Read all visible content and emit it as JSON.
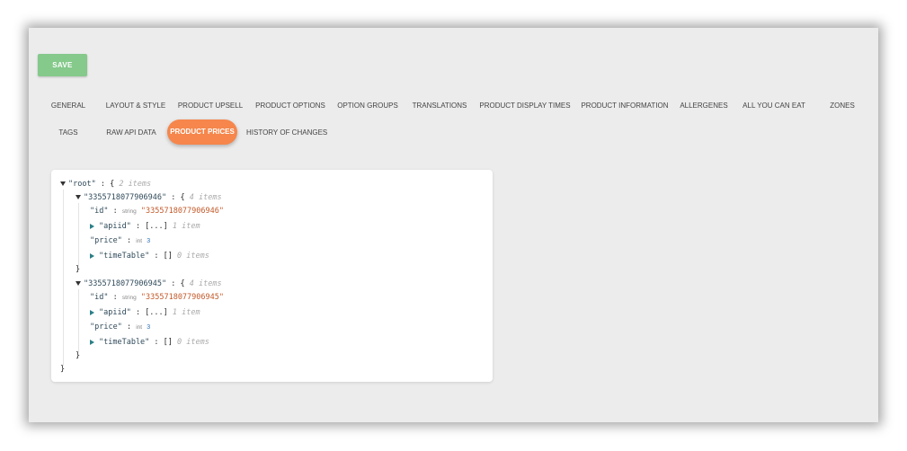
{
  "toolbar": {
    "save_label": "SAVE"
  },
  "tabs": [
    {
      "label": "GENERAL"
    },
    {
      "label": "LAYOUT & STYLE"
    },
    {
      "label": "PRODUCT UPSELL"
    },
    {
      "label": "PRODUCT OPTIONS"
    },
    {
      "label": "OPTION GROUPS"
    },
    {
      "label": "TRANSLATIONS"
    },
    {
      "label": "PRODUCT DISPLAY TIMES"
    },
    {
      "label": "PRODUCT INFORMATION"
    },
    {
      "label": "ALLERGENES"
    },
    {
      "label": "ALL YOU CAN EAT"
    },
    {
      "label": "ZONES"
    },
    {
      "label": "TAGS"
    },
    {
      "label": "RAW API DATA"
    },
    {
      "label": "PRODUCT PRICES"
    },
    {
      "label": "HISTORY OF CHANGES"
    }
  ],
  "active_tab": "PRODUCT PRICES",
  "colors": {
    "save": "#85c98b",
    "active_tab": "#f6864b",
    "string_value": "#c35a2a",
    "int_value": "#2b6fb5"
  },
  "json": {
    "root_key": "\"root\"",
    "root_open": "{",
    "root_count": "2 items",
    "entries": [
      {
        "key": "\"3355718077906946\"",
        "open": "{",
        "count": "4 items",
        "id_key": "\"id\"",
        "id_type": "string",
        "id_value": "\"3355718077906946\"",
        "apiid_key": "\"apiid\"",
        "apiid_value": "[...]",
        "apiid_count": "1 item",
        "price_key": "\"price\"",
        "price_type": "int",
        "price_value": "3",
        "timetable_key": "\"timeTable\"",
        "timetable_value": "[]",
        "timetable_count": "0 items",
        "close": "}"
      },
      {
        "key": "\"3355718077906945\"",
        "open": "{",
        "count": "4 items",
        "id_key": "\"id\"",
        "id_type": "string",
        "id_value": "\"3355718077906945\"",
        "apiid_key": "\"apiid\"",
        "apiid_value": "[...]",
        "apiid_count": "1 item",
        "price_key": "\"price\"",
        "price_type": "int",
        "price_value": "3",
        "timetable_key": "\"timeTable\"",
        "timetable_value": "[]",
        "timetable_count": "0 items",
        "close": "}"
      }
    ],
    "root_close": "}"
  }
}
